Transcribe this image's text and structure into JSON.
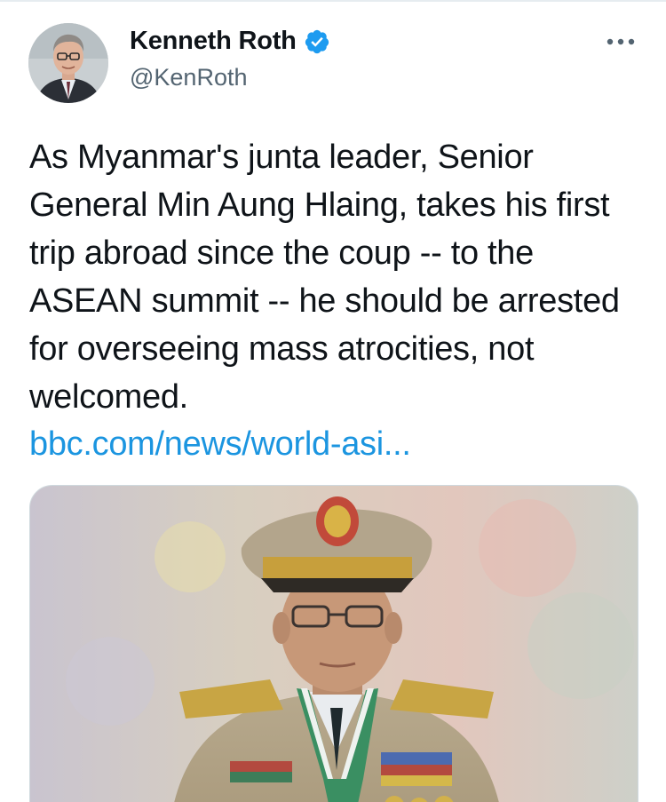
{
  "author": {
    "display_name": "Kenneth Roth",
    "handle": "@KenRoth",
    "verified": true,
    "verified_badge": "verified-check-icon",
    "avatar": "avatar-photo"
  },
  "menu": {
    "icon": "more-horizontal-icon"
  },
  "tweet": {
    "text": "As Myanmar's junta leader, Senior General Min Aung Hlaing, takes his first trip abroad since the coup -- to the ASEAN summit -- he should be arrested for overseeing mass atrocities, not welcomed.",
    "link": "bbc.com/news/world-asi..."
  },
  "media": {
    "kind": "photo"
  },
  "colors": {
    "link": "#1b95e0",
    "verified": "#1d9bf0",
    "secondary_text": "#536471",
    "primary_text": "#0f1419"
  }
}
